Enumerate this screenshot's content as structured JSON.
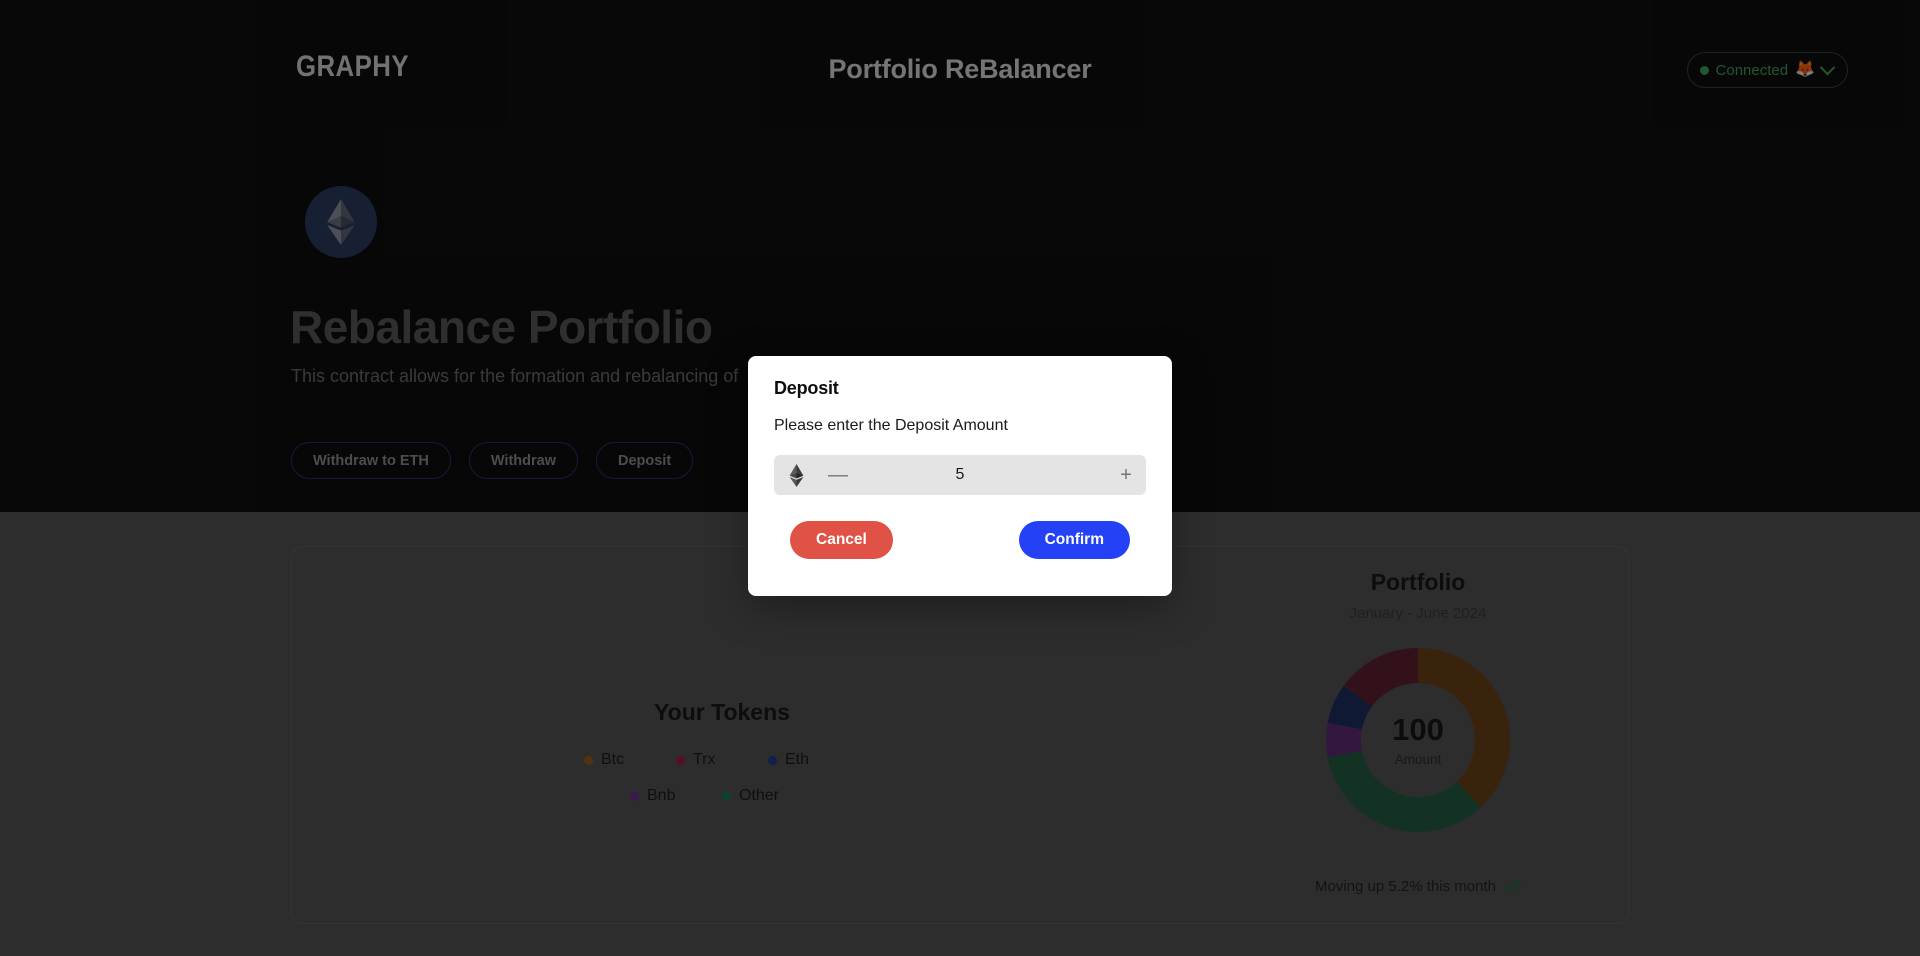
{
  "header": {
    "logo": "GRAPHY",
    "app_title": "Portfolio ReBalancer",
    "wallet": {
      "status_label": "Connected",
      "status_color": "#3c9e56",
      "wallet_icon": "metamask-fox",
      "wallet_emoji": "🦊",
      "chevron_icon": "chevron-down-icon"
    }
  },
  "hero": {
    "token_icon": "ethereum-icon",
    "heading": "Rebalance Portfolio",
    "description": "This contract allows for the formation and rebalancing of",
    "actions": [
      {
        "label": "Withdraw to ETH",
        "name": "withdraw-to-eth-button"
      },
      {
        "label": "Withdraw",
        "name": "withdraw-button"
      },
      {
        "label": "Deposit",
        "name": "deposit-button"
      }
    ],
    "border_color": "#2c2f6b"
  },
  "panel": {
    "tokens": {
      "title": "Your Tokens",
      "legend": [
        {
          "label": "Btc",
          "color": "#9a5b1f"
        },
        {
          "label": "Trx",
          "color": "#9c2040"
        },
        {
          "label": "Eth",
          "color": "#1e3a8a"
        },
        {
          "label": "Bnb",
          "color": "#6b2f8f"
        },
        {
          "label": "Other",
          "color": "#137a4f"
        }
      ]
    },
    "chart_card": {
      "title": "Portfolio",
      "subtitle": "January - June 2024",
      "center_value": "100",
      "center_label": "Amount",
      "footer_text": "Moving up 5.2% this month",
      "footer_icon": "trending-up-icon",
      "footer_icon_color": "#1f6b42"
    }
  },
  "chart_data": {
    "type": "pie",
    "title": "Portfolio",
    "subtitle": "January - June 2024",
    "center_value": 100,
    "center_label": "Amount",
    "legend_position": "left",
    "grid": false,
    "categories": [
      "Btc",
      "Other",
      "Bnb",
      "Eth",
      "Trx"
    ],
    "values": [
      38,
      34,
      6,
      7,
      15
    ],
    "colors": [
      "#6b4018",
      "#245c42",
      "#5e2a72",
      "#1d2f5e",
      "#5c2030"
    ],
    "legend_colors": [
      "#9a5b1f",
      "#137a4f",
      "#6b2f8f",
      "#1e3a8a",
      "#9c2040"
    ],
    "units": "percent",
    "xlabel": "",
    "ylabel": ""
  },
  "modal": {
    "title": "Deposit",
    "prompt": "Please enter the Deposit Amount",
    "amount_icon": "ethereum-icon",
    "amount_value": "5",
    "amount_placeholder": "0",
    "decrement_label": "—",
    "increment_label": "+",
    "cancel_label": "Cancel",
    "confirm_label": "Confirm",
    "cancel_color": "#e05146",
    "confirm_color": "#2541f5"
  }
}
